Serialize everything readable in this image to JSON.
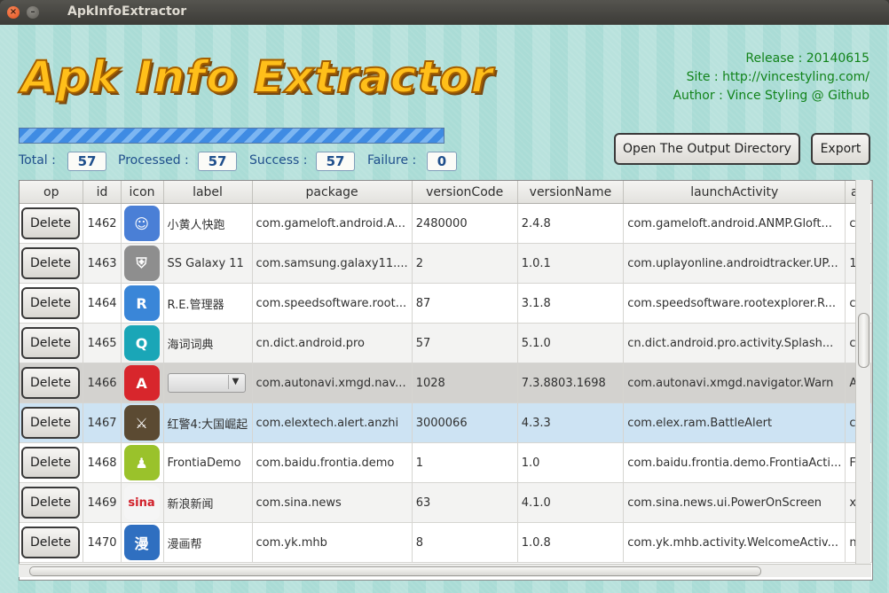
{
  "window": {
    "title": "ApkInfoExtractor"
  },
  "header": {
    "logo_text": "Apk Info Extractor",
    "release": "Release : 20140615",
    "site": "Site : http://vincestyling.com/",
    "author": "Author : Vince Styling @ Github"
  },
  "progress": {
    "percent": 100
  },
  "stats": {
    "total_label": "Total :",
    "total": "57",
    "processed_label": "Processed :",
    "processed": "57",
    "success_label": "Success :",
    "success": "57",
    "failure_label": "Failure :",
    "failure": "0"
  },
  "buttons": {
    "open_output": "Open The Output Directory",
    "export": "Export"
  },
  "table": {
    "columns": [
      "op",
      "id",
      "icon",
      "label",
      "package",
      "versionCode",
      "versionName",
      "launchActivity",
      "ap"
    ],
    "delete_label": "Delete",
    "rows": [
      {
        "id": "1462",
        "icon": "minion-icon",
        "label": "小黄人快跑",
        "package": "com.gameloft.android.A...",
        "versionCode": "2480000",
        "versionName": "2.4.8",
        "launchActivity": "com.gameloft.android.ANMP.Gloft...",
        "extra": "c"
      },
      {
        "id": "1463",
        "icon": "shield-icon",
        "label": "SS Galaxy 11",
        "package": "com.samsung.galaxy11....",
        "versionCode": "2",
        "versionName": "1.0.1",
        "launchActivity": "com.uplayonline.androidtracker.UP...",
        "extra": "1"
      },
      {
        "id": "1464",
        "icon": "re-manager-icon",
        "label": "R.E.管理器",
        "package": "com.speedsoftware.root...",
        "versionCode": "87",
        "versionName": "3.1.8",
        "launchActivity": "com.speedsoftware.rootexplorer.R...",
        "extra": "c"
      },
      {
        "id": "1465",
        "icon": "dict-search-icon",
        "label": "海词词典",
        "package": "cn.dict.android.pro",
        "versionCode": "57",
        "versionName": "5.1.0",
        "launchActivity": "cn.dict.android.pro.activity.Splash...",
        "extra": "c"
      },
      {
        "id": "1466",
        "icon": "autonavi-icon",
        "label": "",
        "package": "com.autonavi.xmgd.nav...",
        "versionCode": "1028",
        "versionName": "7.3.8803.1698",
        "launchActivity": "com.autonavi.xmgd.navigator.Warn",
        "extra": "A"
      },
      {
        "id": "1467",
        "icon": "red-alert-icon",
        "label": "红警4:大国崛起",
        "package": "com.elextech.alert.anzhi",
        "versionCode": "3000066",
        "versionName": "4.3.3",
        "launchActivity": "com.elex.ram.BattleAlert",
        "extra": "c"
      },
      {
        "id": "1468",
        "icon": "android-robot-icon",
        "label": "FrontiaDemo",
        "package": "com.baidu.frontia.demo",
        "versionCode": "1",
        "versionName": "1.0",
        "launchActivity": "com.baidu.frontia.demo.FrontiaActi...",
        "extra": "F"
      },
      {
        "id": "1469",
        "icon": "sina-icon",
        "label": "新浪新闻",
        "package": "com.sina.news",
        "versionCode": "63",
        "versionName": "4.1.0",
        "launchActivity": "com.sina.news.ui.PowerOnScreen",
        "extra": "x"
      },
      {
        "id": "1470",
        "icon": "manhua-icon",
        "label": "漫画帮",
        "package": "com.yk.mhb",
        "versionCode": "8",
        "versionName": "1.0.8",
        "launchActivity": "com.yk.mhb.activity.WelcomeActiv...",
        "extra": "n"
      }
    ]
  },
  "icon_glyphs": {
    "minion-icon": "☺",
    "shield-icon": "⛨",
    "re-manager-icon": "R",
    "dict-search-icon": "Q",
    "autonavi-icon": "A",
    "red-alert-icon": "⚔",
    "android-robot-icon": "♟",
    "sina-icon": "sina",
    "manhua-icon": "漫"
  },
  "icon_colors": {
    "minion-icon": "#4a7fd6",
    "shield-icon": "#8e8e8e",
    "re-manager-icon": "#3a86d8",
    "dict-search-icon": "#1aa6b7",
    "autonavi-icon": "#d8262c",
    "red-alert-icon": "#5b4a32",
    "android-robot-icon": "#9ac22b",
    "sina-icon": "#f5f5f5",
    "manhua-icon": "#2f6fc0"
  },
  "colors": {
    "info_text": "#11831a",
    "stat_text": "#1f4f8c",
    "logo": "#ffbf1a",
    "selected_row": "#cde3f3"
  }
}
